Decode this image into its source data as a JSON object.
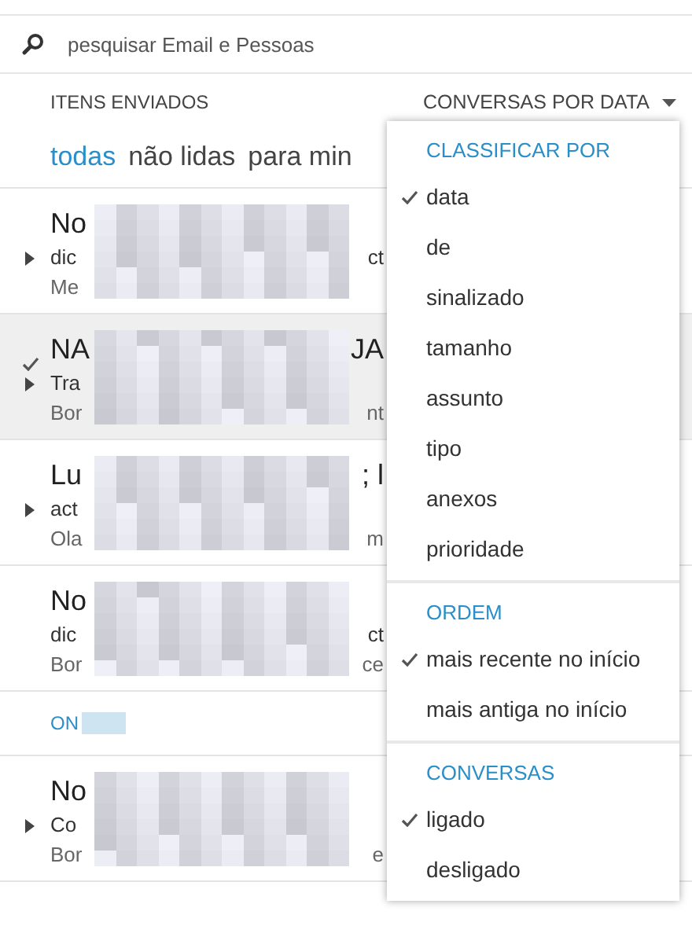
{
  "search": {
    "placeholder": "pesquisar Email e Pessoas"
  },
  "folder_title": "ITENS ENVIADOS",
  "sort_button": {
    "label": "CONVERSAS POR DATA"
  },
  "filters": [
    {
      "label": "todas",
      "selected": true
    },
    {
      "label": "não lidas",
      "selected": false
    },
    {
      "label": "para min",
      "selected": false
    }
  ],
  "messages": [
    {
      "kind": "message",
      "selected": false,
      "checked": false,
      "expandable": true,
      "sender": {
        "start": "No"
      },
      "subject": {
        "start": "dic",
        "end": "ct"
      },
      "preview": {
        "start": "Me"
      }
    },
    {
      "kind": "message",
      "selected": true,
      "checked": true,
      "expandable": true,
      "sender": {
        "start": "NA",
        "end": "JA"
      },
      "subject": {
        "start": "Tra"
      },
      "preview": {
        "start": "Bor",
        "end": "nt"
      }
    },
    {
      "kind": "message",
      "selected": false,
      "checked": false,
      "expandable": true,
      "sender": {
        "start": "Lu",
        "end": "; l"
      },
      "subject": {
        "start": "act"
      },
      "preview": {
        "start": "Ola",
        "end": "m"
      }
    },
    {
      "kind": "message",
      "selected": false,
      "checked": false,
      "expandable": false,
      "sender": {
        "start": "No"
      },
      "subject": {
        "start": "dic",
        "end": "ct"
      },
      "preview": {
        "start": "Bor",
        "end": "ce"
      }
    },
    {
      "kind": "group",
      "label": "ON"
    },
    {
      "kind": "message",
      "selected": false,
      "checked": false,
      "expandable": true,
      "sender": {
        "start": "No"
      },
      "subject": {
        "start": "Co"
      },
      "preview": {
        "start": "Bor",
        "end": "e"
      }
    }
  ],
  "sort_menu": [
    {
      "heading": "CLASSIFICAR POR",
      "items": [
        {
          "label": "data",
          "selected": true
        },
        {
          "label": "de",
          "selected": false
        },
        {
          "label": "sinalizado",
          "selected": false
        },
        {
          "label": "tamanho",
          "selected": false
        },
        {
          "label": "assunto",
          "selected": false
        },
        {
          "label": "tipo",
          "selected": false
        },
        {
          "label": "anexos",
          "selected": false
        },
        {
          "label": "prioridade",
          "selected": false
        }
      ]
    },
    {
      "heading": "ORDEM",
      "items": [
        {
          "label": "mais recente no início",
          "selected": true
        },
        {
          "label": "mais antiga no início",
          "selected": false
        }
      ]
    },
    {
      "heading": "CONVERSAS",
      "items": [
        {
          "label": "ligado",
          "selected": true
        },
        {
          "label": "desligado",
          "selected": false
        }
      ]
    }
  ]
}
